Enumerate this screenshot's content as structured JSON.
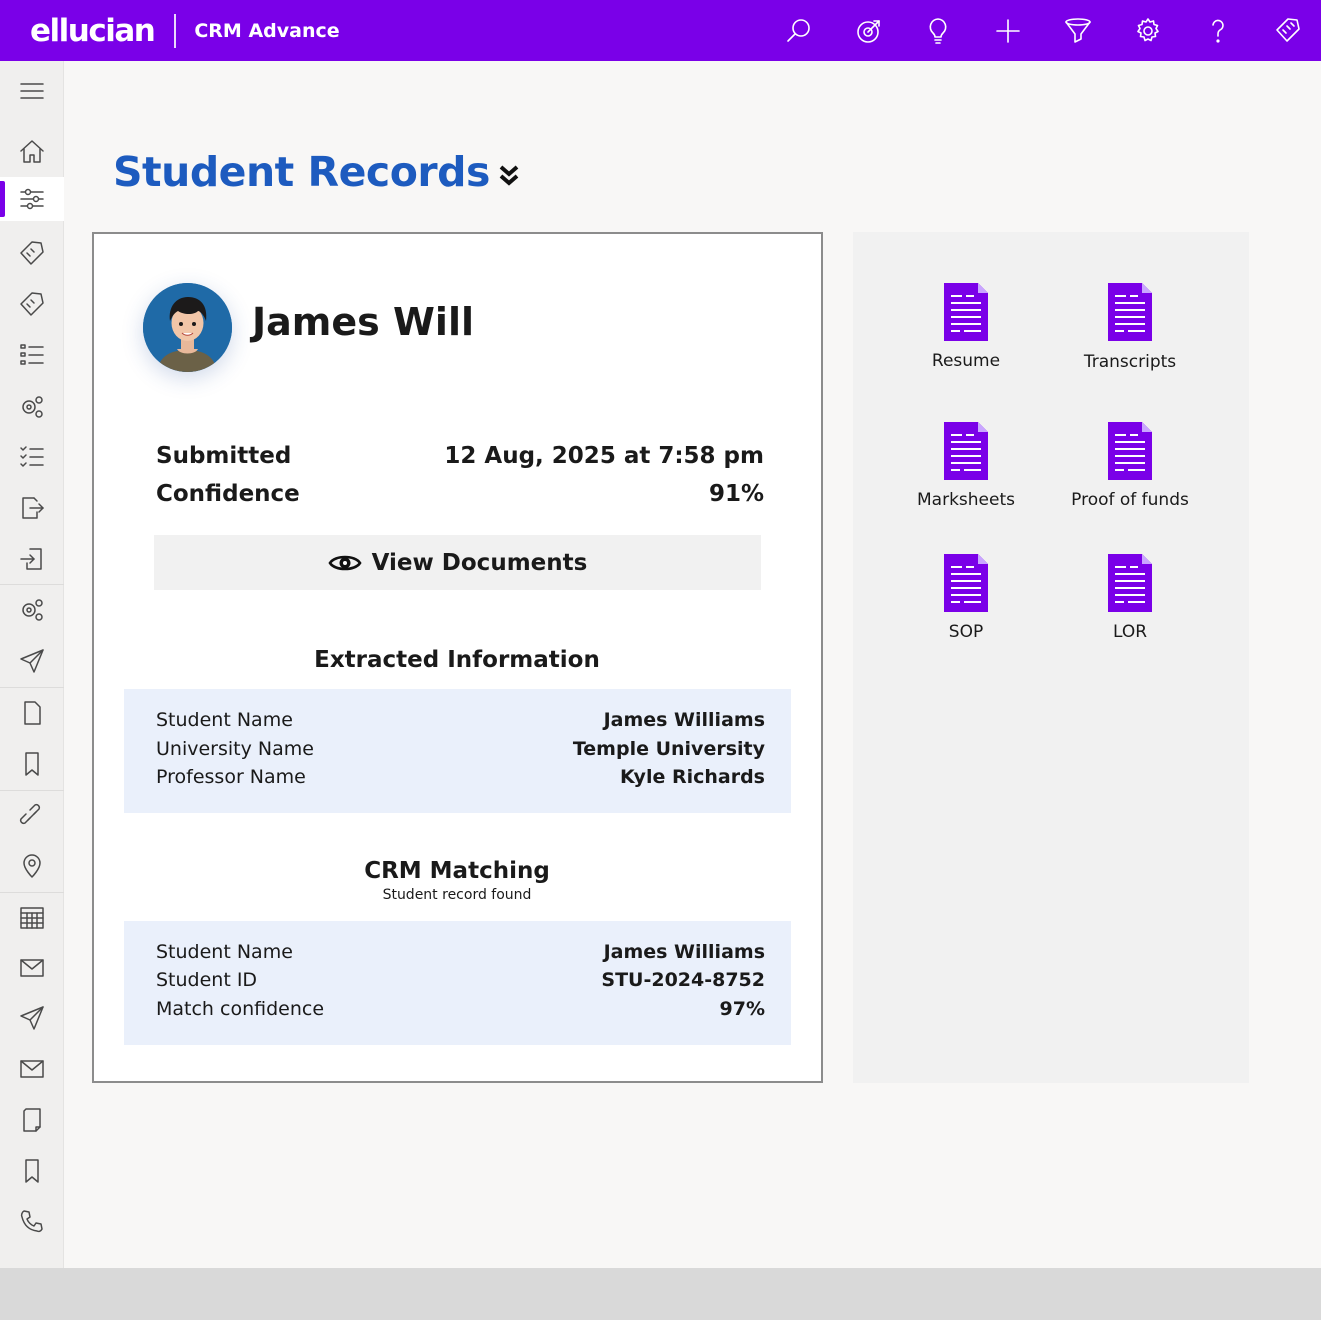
{
  "colors": {
    "brand": "#7a00e8",
    "title": "#1d5bbf",
    "doc_icon": "#7a00e8",
    "info_bg": "#eaf0fb"
  },
  "header": {
    "logo": "ellucian",
    "product": "CRM Advance",
    "actions": [
      "search-icon",
      "target-icon",
      "lightbulb-icon",
      "plus-icon",
      "filter-icon",
      "gear-icon",
      "help-icon",
      "tag-icon"
    ]
  },
  "sidebar": {
    "items": [
      "menu-icon",
      "home-icon",
      "sliders-icon",
      "tag-icon",
      "tag-icon",
      "list-icon",
      "gears-icon",
      "checklist-icon",
      "export-icon",
      "import-icon",
      "gears-icon",
      "send-icon",
      "document-icon",
      "bookmark-icon",
      "link-icon",
      "location-icon",
      "calendar-icon",
      "mail-icon",
      "send-icon",
      "mail-icon",
      "notes-icon",
      "bookmark-icon",
      "phone-icon"
    ],
    "active_index": 2
  },
  "page": {
    "title": "Student Records"
  },
  "record": {
    "name": "James Will",
    "submitted_label": "Submitted",
    "submitted_value": "12 Aug, 2025 at 7:58 pm",
    "confidence_label": "Confidence",
    "confidence_value": "91%",
    "view_documents": "View Documents"
  },
  "extracted": {
    "title": "Extracted Information",
    "rows": [
      {
        "label": "Student Name",
        "value": "James Williams"
      },
      {
        "label": "University Name",
        "value": "Temple University"
      },
      {
        "label": "Professor Name",
        "value": "Kyle Richards"
      }
    ]
  },
  "crm": {
    "title": "CRM Matching",
    "subtitle": "Student record found",
    "rows": [
      {
        "label": "Student Name",
        "value": "James Williams"
      },
      {
        "label": "Student ID",
        "value": "STU-2024-8752"
      },
      {
        "label": "Match confidence",
        "value": "97%"
      }
    ]
  },
  "documents": [
    {
      "label": "Resume"
    },
    {
      "label": "Transcripts"
    },
    {
      "label": "Marksheets"
    },
    {
      "label": "Proof of funds"
    },
    {
      "label": "SOP"
    },
    {
      "label": "LOR"
    }
  ]
}
